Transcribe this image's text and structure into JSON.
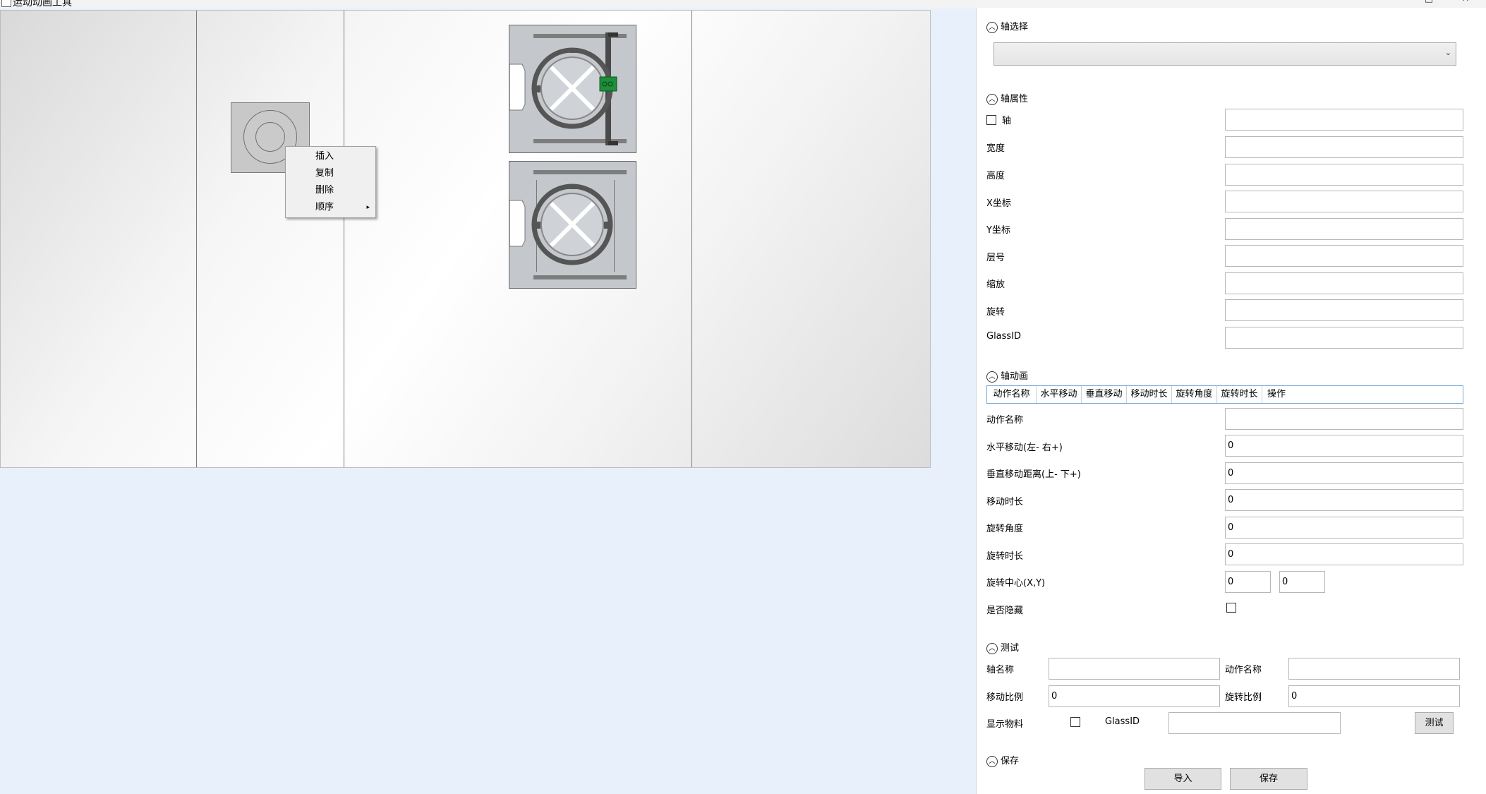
{
  "window": {
    "title": "运动动画工具"
  },
  "context_menu": {
    "items": [
      {
        "label": "插入"
      },
      {
        "label": "复制"
      },
      {
        "label": "删除"
      },
      {
        "label": "顺序",
        "submenu_arrow": "▸"
      }
    ]
  },
  "panel": {
    "axis_select": {
      "header": "轴选择",
      "selected": ""
    },
    "axis_props": {
      "header": "轴属性",
      "axis_checkbox_label": "轴",
      "fields": [
        {
          "label": "宽度",
          "value": ""
        },
        {
          "label": "高度",
          "value": ""
        },
        {
          "label": "X坐标",
          "value": ""
        },
        {
          "label": "Y坐标",
          "value": ""
        },
        {
          "label": "层号",
          "value": ""
        },
        {
          "label": "缩放",
          "value": ""
        },
        {
          "label": "旋转",
          "value": ""
        },
        {
          "label": "GlassID",
          "value": ""
        }
      ]
    },
    "axis_anim": {
      "header": "轴动画",
      "columns": [
        "动作名称",
        "水平移动",
        "垂直移动",
        "移动时长",
        "旋转角度",
        "旋转时长",
        "操作"
      ],
      "fields": [
        {
          "label": "动作名称",
          "value": ""
        },
        {
          "label": "水平移动(左- 右+)",
          "value": "0"
        },
        {
          "label": "垂直移动距离(上- 下+)",
          "value": "0"
        },
        {
          "label": "移动时长",
          "value": "0"
        },
        {
          "label": "旋转角度",
          "value": "0"
        },
        {
          "label": "旋转时长",
          "value": "0"
        }
      ],
      "rotation_center": {
        "label": "旋转中心(X,Y)",
        "x": "0",
        "y": "0"
      },
      "hidden_label": "是否隐藏"
    },
    "test": {
      "header": "测试",
      "axis_name_label": "轴名称",
      "axis_name_value": "",
      "action_name_label": "动作名称",
      "action_name_value": "",
      "move_ratio_label": "移动比例",
      "move_ratio_value": "0",
      "rotate_ratio_label": "旋转比例",
      "rotate_ratio_value": "0",
      "show_material_label": "显示物料",
      "glassid_label": "GlassID",
      "glassid_value": "",
      "test_button": "测试"
    },
    "save": {
      "header": "保存",
      "import_button": "导入",
      "save_button": "保存"
    }
  },
  "icons": {
    "collapse": "chevron-up-icon",
    "dropdown": "chevron-down-icon",
    "submenu": "chevron-right-icon"
  }
}
